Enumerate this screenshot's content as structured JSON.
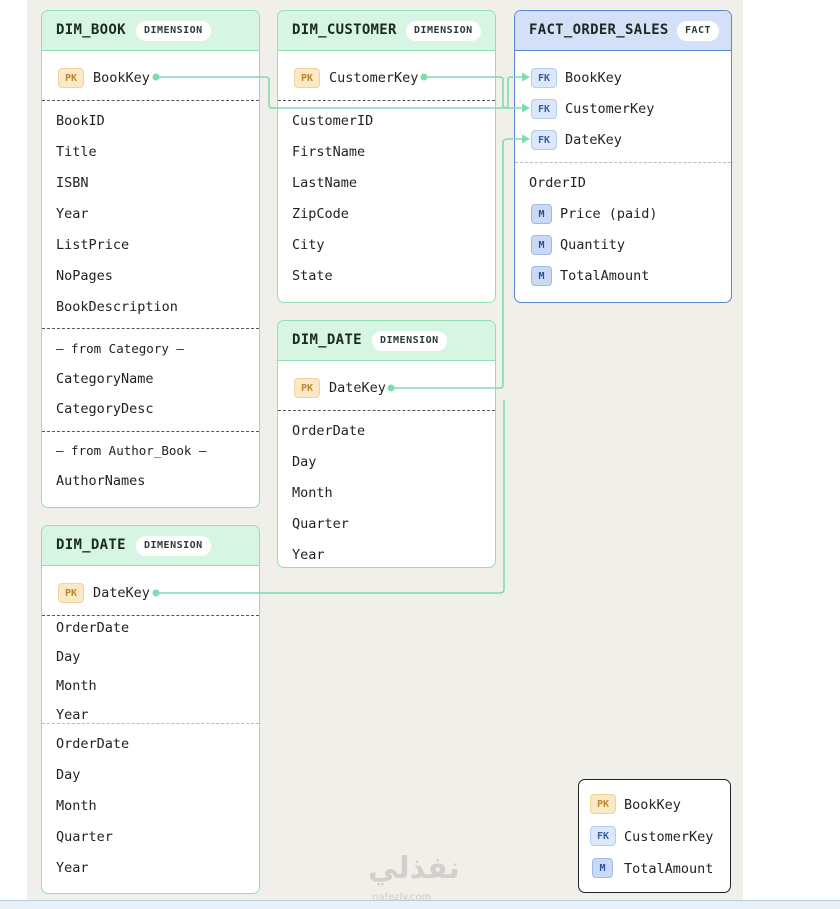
{
  "tables": {
    "dim_book": {
      "name": "DIM_BOOK",
      "badge": "DIMENSION",
      "key": {
        "tag": "PK",
        "label": "BookKey"
      },
      "fields": [
        "BookID",
        "Title",
        "ISBN",
        "Year",
        "ListPrice",
        "NoPages",
        "BookDescription"
      ],
      "section_category": {
        "label": "— from Category —",
        "fields": [
          "CategoryName",
          "CategoryDesc"
        ]
      },
      "section_author": {
        "label": "— from Author_Book —",
        "fields": [
          "AuthorNames"
        ]
      }
    },
    "dim_customer": {
      "name": "DIM_CUSTOMER",
      "badge": "DIMENSION",
      "key": {
        "tag": "PK",
        "label": "CustomerKey"
      },
      "fields": [
        "CustomerID",
        "FirstName",
        "LastName",
        "ZipCode",
        "City",
        "State"
      ]
    },
    "fact_order_sales": {
      "name": "FACT_ORDER_SALES",
      "badge": "FACT",
      "keys": [
        {
          "tag": "FK",
          "label": "BookKey"
        },
        {
          "tag": "FK",
          "label": "CustomerKey"
        },
        {
          "tag": "FK",
          "label": "DateKey"
        }
      ],
      "field": "OrderID",
      "measures": [
        {
          "tag": "M",
          "label": "Price (paid)"
        },
        {
          "tag": "M",
          "label": "Quantity"
        },
        {
          "tag": "M",
          "label": "TotalAmount"
        }
      ]
    },
    "dim_date_mid": {
      "name": "DIM_DATE",
      "badge": "DIMENSION",
      "key": {
        "tag": "PK",
        "label": "DateKey"
      },
      "fields": [
        "OrderDate",
        "Day",
        "Month",
        "Quarter",
        "Year"
      ]
    },
    "dim_date_left": {
      "name": "DIM_DATE",
      "badge": "DIMENSION",
      "key": {
        "tag": "PK",
        "label": "DateKey"
      },
      "fields_a": [
        "OrderDate",
        "Day",
        "Month",
        "Year"
      ],
      "fields_b": [
        "OrderDate",
        "Day",
        "Month",
        "Quarter",
        "Year"
      ]
    }
  },
  "legend": [
    {
      "tag": "PK",
      "label": "BookKey"
    },
    {
      "tag": "FK",
      "label": "CustomerKey"
    },
    {
      "tag": "M",
      "label": "TotalAmount"
    }
  ],
  "watermark": {
    "arabic": "نفذلي",
    "latin": "nafezly.com"
  },
  "colors": {
    "dimension_border": "#8fe0b4",
    "dimension_header": "#d6f5e3",
    "fact_border": "#5b86d6",
    "fact_header": "#d3e0f7",
    "link": "#7fdcaf"
  }
}
